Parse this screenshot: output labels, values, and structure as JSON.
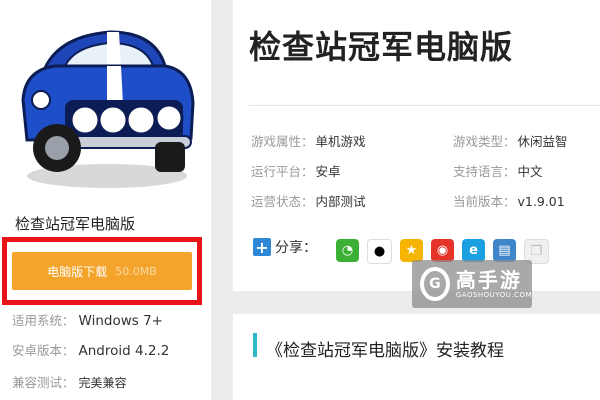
{
  "app": {
    "name": "检查站冠军电脑版",
    "title": "检查站冠军电脑版",
    "icon": "blue-muscle-car-icon"
  },
  "download": {
    "label": "电脑版下载",
    "size": "50.0MB"
  },
  "specs": [
    {
      "label": "适用系统：",
      "value": "Windows 7+"
    },
    {
      "label": "安卓版本：",
      "value": "Android 4.2.2"
    },
    {
      "label": "兼容测试：",
      "value": "完美兼容"
    }
  ],
  "attributes": [
    {
      "label": "游戏属性：",
      "value": "单机游戏"
    },
    {
      "label": "游戏类型：",
      "value": "休闲益智"
    },
    {
      "label": "运行平台：",
      "value": "安卓"
    },
    {
      "label": "支持语言：",
      "value": "中文"
    },
    {
      "label": "运营状态：",
      "value": "内部测试"
    },
    {
      "label": "当前版本：",
      "value": "v1.9.01"
    }
  ],
  "share": {
    "label": "分享：",
    "icons": [
      "wechat-icon",
      "qq-icon",
      "qzone-icon",
      "weibo-icon",
      "tencent-weibo-icon",
      "print-icon",
      "copy-icon"
    ]
  },
  "watermark": {
    "cn": "高手游",
    "en": "GAOSHOUYOU.COM"
  },
  "tutorial": {
    "title": "《检查站冠军电脑版》安装教程"
  },
  "colors": {
    "download_button": "#f4a32b",
    "highlight_frame": "#e8141a",
    "tutorial_accent": "#2fb8c8"
  }
}
